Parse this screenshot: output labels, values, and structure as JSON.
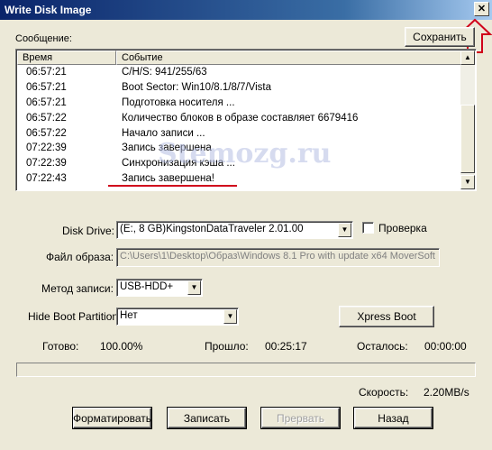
{
  "window": {
    "title": "Write Disk Image",
    "close_glyph": "✕"
  },
  "log": {
    "label": "Сообщение:",
    "save_button": "Сохранить",
    "columns": [
      "Время",
      "Событие"
    ],
    "rows": [
      {
        "time": "06:57:21",
        "event": "C/H/S: 941/255/63"
      },
      {
        "time": "06:57:21",
        "event": "Boot Sector: Win10/8.1/8/7/Vista"
      },
      {
        "time": "06:57:21",
        "event": "Подготовка носителя ..."
      },
      {
        "time": "06:57:22",
        "event": "Количество блоков в образе составляет 6679416"
      },
      {
        "time": "06:57:22",
        "event": "Начало записи ..."
      },
      {
        "time": "07:22:39",
        "event": "Запись завершена"
      },
      {
        "time": "07:22:39",
        "event": "Синхронизация кэша ..."
      },
      {
        "time": "07:22:43",
        "event": "Запись завершена!"
      }
    ]
  },
  "form": {
    "disk_drive_label": "Disk Drive:",
    "disk_drive_value": "(E:, 8 GB)KingstonDataTraveler 2.01.00",
    "verify_label": "Проверка",
    "image_file_label": "Файл образа:",
    "image_file_value": "C:\\Users\\1\\Desktop\\Образ\\Windows 8.1 Pro with update x64 MoverSoft",
    "write_method_label": "Метод записи:",
    "write_method_value": "USB-HDD+",
    "hide_boot_label": "Hide Boot Partition:",
    "hide_boot_value": "Нет",
    "xpress_boot_button": "Xpress Boot"
  },
  "status": {
    "done_label": "Готово:",
    "done_value": "100.00%",
    "elapsed_label": "Прошло:",
    "elapsed_value": "00:25:17",
    "remaining_label": "Осталось:",
    "remaining_value": "00:00:00",
    "speed_label": "Скорость:",
    "speed_value": "2.20MB/s",
    "progress_fraction": 0
  },
  "buttons": {
    "format": "Форматировать",
    "write": "Записать",
    "abort": "Прервать",
    "back": "Назад"
  },
  "watermark": "Stemozg.ru",
  "colors": {
    "annotation_red": "#d0021b",
    "title_start": "#0a246a",
    "title_end": "#a6caf0"
  },
  "icons": [
    "close-icon",
    "scroll-up-icon",
    "scroll-down-icon",
    "dropdown-arrow-icon",
    "annotation-arrow-icon"
  ]
}
